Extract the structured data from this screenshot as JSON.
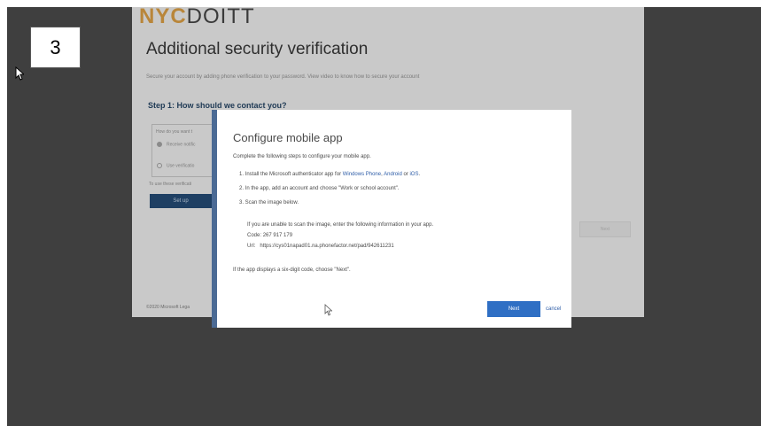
{
  "step_badge": "3",
  "logo": {
    "nyc": "NYC",
    "doitt": "DOITT"
  },
  "page": {
    "title": "Additional security verification",
    "description": "Secure your account by adding phone verification to your password. View video to know how to secure your account",
    "step_heading": "Step 1: How should we contact you?",
    "method_legend": "How do you want t",
    "option1": "Receive notific",
    "option2": "Use verificatio",
    "use_text": "To use these verificati",
    "setup_button": "Set up",
    "next_button": "Next",
    "footer": "©2020 Microsoft    Lega"
  },
  "modal": {
    "title": "Configure mobile app",
    "intro": "Complete the following steps to configure your mobile app.",
    "step1_prefix": "1. Install the Microsoft authenticator app for ",
    "link_windows": "Windows Phone",
    "sep1": ", ",
    "link_android": "Android",
    "sep2": " or ",
    "link_ios": "iOS",
    "step1_suffix": ".",
    "step2": "2. In the app, add an account and choose \"Work or school account\".",
    "step3": "3. Scan the image below.",
    "unable_text": "If you are unable to scan the image, enter the following information in your app.",
    "code_label": "Code:",
    "code_value": "267 917 179",
    "url_label": "Url:",
    "url_value": "https://cys01napad01.na.phonefactor.net/pad/942611231",
    "six_digit": "If the app displays a six-digit code, choose \"Next\".",
    "next_label": "Next",
    "cancel_label": "cancel"
  },
  "colors": {
    "primary_button": "#2f6fc4",
    "link": "#2f5ea8",
    "brand_gold": "#b9863a",
    "overlay": "#3f3f3f"
  },
  "icons": {
    "cursor": "arrow-cursor-icon",
    "hover_cursor": "pointer-cursor-icon"
  }
}
